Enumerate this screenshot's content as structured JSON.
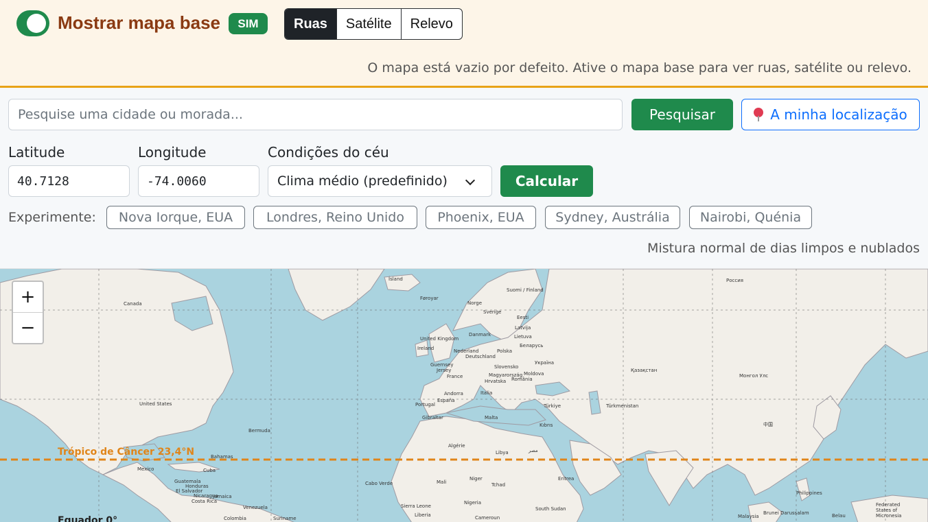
{
  "banner": {
    "toggle_on": true,
    "title": "Mostrar mapa base",
    "badge": "SIM",
    "layers": [
      "Ruas",
      "Satélite",
      "Relevo"
    ],
    "active_layer": "Ruas",
    "hint": "O mapa está vazio por defeito. Ative o mapa base para ver ruas, satélite ou relevo."
  },
  "search": {
    "placeholder": "Pesquise uma cidade ou morada...",
    "button": "Pesquisar",
    "location_button": "A minha localização",
    "location_icon": "map-pin-icon"
  },
  "coords": {
    "lat_label": "Latitude",
    "lat_value": "40.7128",
    "lon_label": "Longitude",
    "lon_value": "-74.0060",
    "sky_label": "Condições do céu",
    "sky_value": "Clima médio (predefinido)",
    "calc_button": "Calcular"
  },
  "presets": {
    "label": "Experimente:",
    "items": [
      "Nova Iorque, EUA",
      "Londres, Reino Unido",
      "Phoenix, EUA",
      "Sydney, Austrália",
      "Nairobi, Quénia"
    ]
  },
  "sky_description": "Mistura normal de dias limpos e nublados",
  "map": {
    "zoom_in": "+",
    "zoom_out": "−",
    "tropic_label": "Trópico de Câncer 23,4°N",
    "equator_label": "Equador 0°",
    "places": [
      "Canada",
      "United States",
      "Bermuda",
      "Bahamas",
      "Cuba",
      "Mexico",
      "Ísland",
      "Føroyar",
      "Norge",
      "Sverige",
      "Suomi / Finland",
      "Eesti",
      "Latvija",
      "Lietuva",
      "Danmark",
      "United Kingdom",
      "Ireland",
      "Nederland",
      "Deutschland",
      "Polska",
      "Беларусь",
      "Україна",
      "France",
      "Slovensko",
      "Magyarország",
      "Moldova",
      "România",
      "Hrvatska",
      "Italia",
      "España",
      "Portugal",
      "Gibraltar",
      "Malta",
      "Türkiye",
      "Kıbrıs",
      "Algérie",
      "Libya",
      "مصر",
      "Mali",
      "Niger",
      "Tchad",
      "Nigeria",
      "Cabo Verde",
      "Россия",
      "Қазақстан",
      "Монгол Улс",
      "中国",
      "Türkmenistan",
      "Philippines",
      "Malaysia",
      "Colombia",
      "Venezuela",
      "Suriname",
      "Jamaica",
      "Guatemala",
      "Honduras",
      "El Salvador",
      "Nicaragua",
      "Costa Rica",
      "Sierra Leone",
      "Liberia",
      "Cameroun",
      "South Sudan",
      "Eritrea",
      "Brunei Darussalam",
      "Federated States of Micronesia",
      "Belau",
      "Andorra",
      "Guernsey",
      "Jersey"
    ]
  }
}
